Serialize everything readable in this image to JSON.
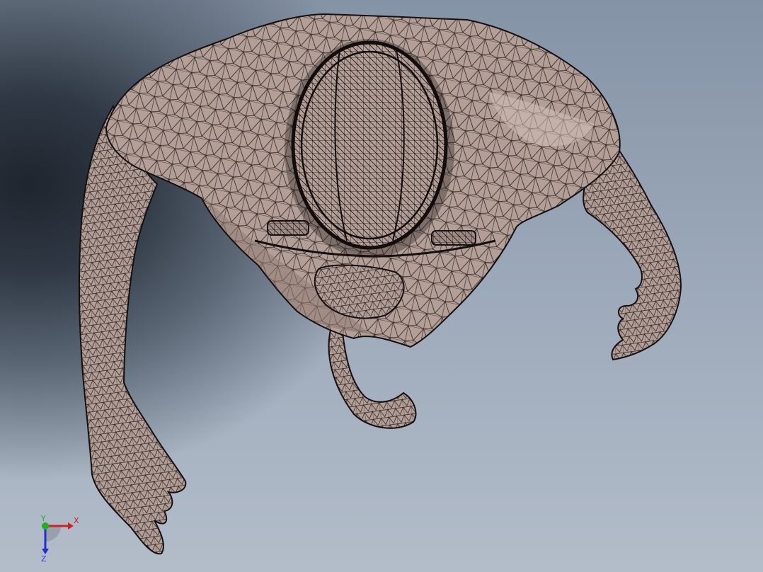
{
  "viewport": {
    "model": "wireframe-human-figure-top-view",
    "mesh_color": "#b39f98",
    "edge_color": "#2a201d",
    "background_top": "#8493a6",
    "background_bottom": "#b3bdca"
  },
  "triad": {
    "x_label": "X",
    "y_label": "Y",
    "z_label": "Z",
    "x_color": "#d02020",
    "y_color": "#20b020",
    "z_color": "#2030d0"
  }
}
